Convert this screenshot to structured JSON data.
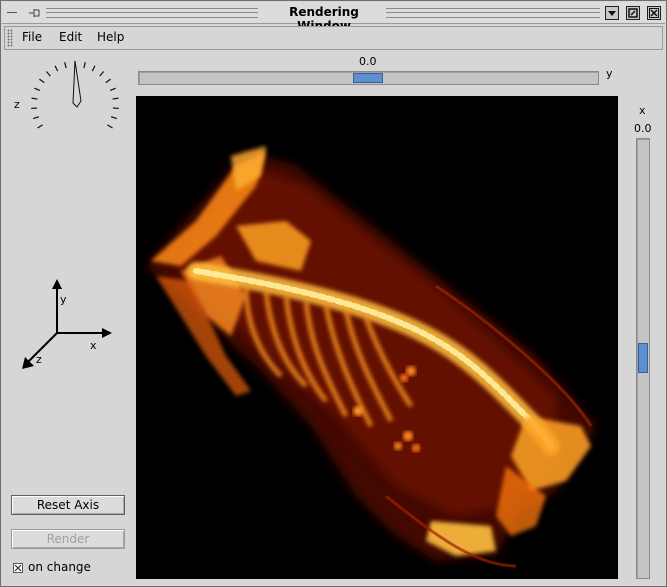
{
  "window": {
    "title": "Rendering Window"
  },
  "menubar": {
    "items": [
      {
        "label": "File"
      },
      {
        "label": "Edit"
      },
      {
        "label": "Help"
      }
    ]
  },
  "dial": {
    "axis_label": "z"
  },
  "axes_widget": {
    "x_label": "x",
    "y_label": "y",
    "z_label": "z"
  },
  "top_slider": {
    "value": "0.0",
    "axis_label": "y",
    "level": 0.5
  },
  "right_slider": {
    "value": "0.0",
    "axis_label": "x",
    "level": 0.5
  },
  "controls": {
    "reset_axis_label": "Reset Axis",
    "render_label": "Render",
    "on_change_label": "on change",
    "on_change_checked": true
  },
  "colors": {
    "slider_thumb": "#5b8fd4",
    "render_background": "#000000",
    "volume_hot": "#ffd24a",
    "volume_mid": "#ff7a10",
    "volume_dark": "#8a1800"
  }
}
